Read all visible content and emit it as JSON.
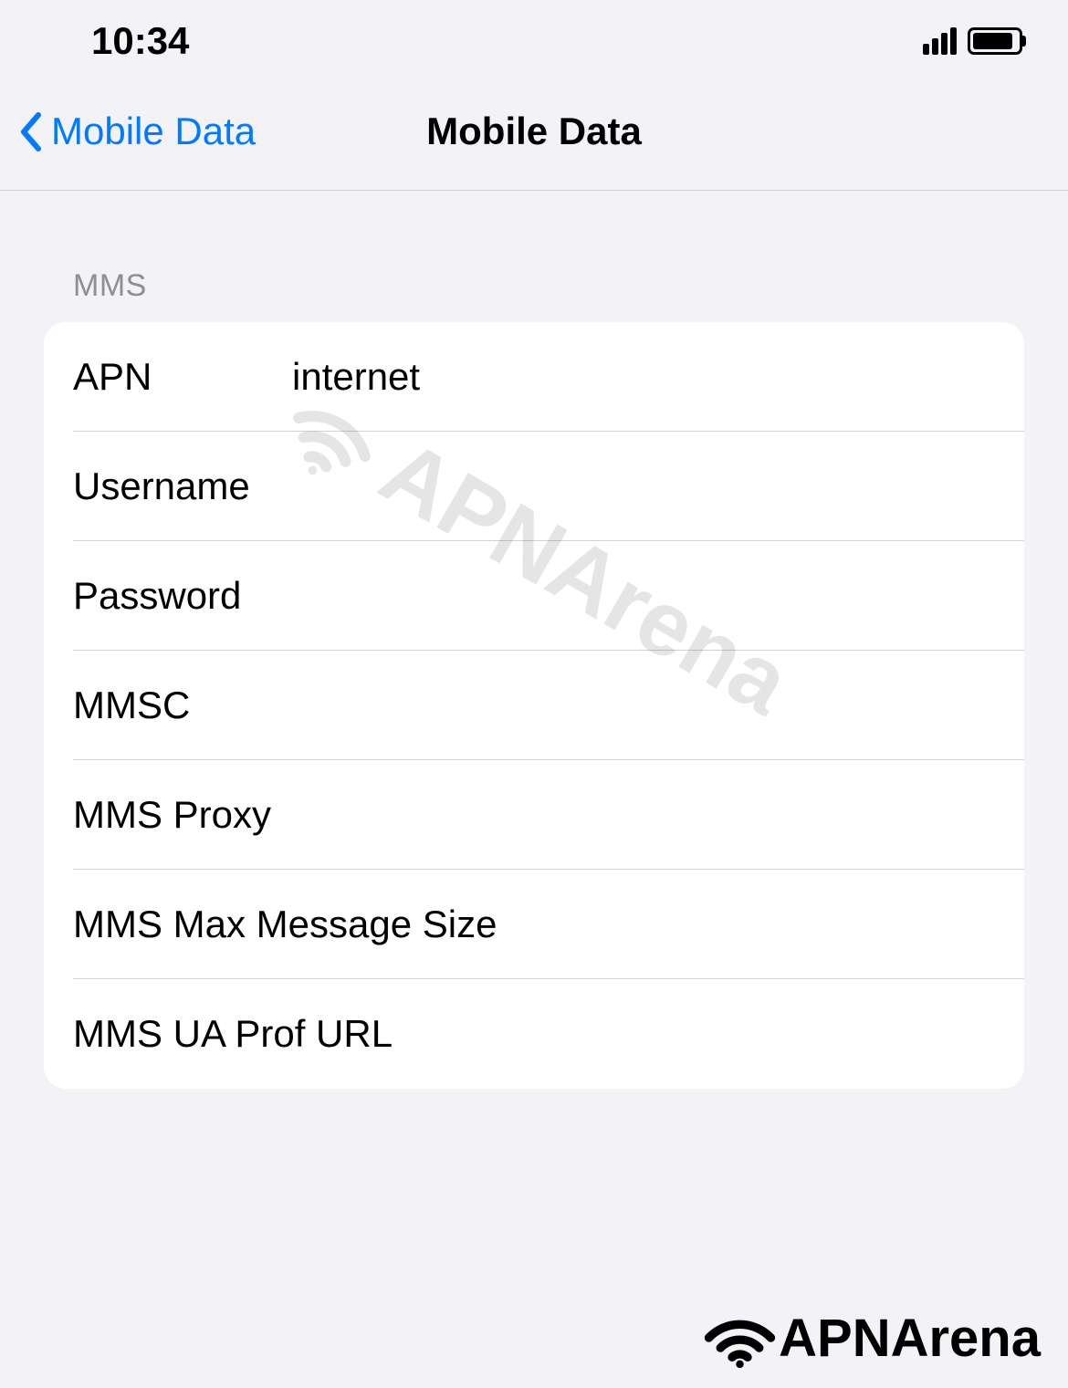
{
  "status_bar": {
    "time": "10:34"
  },
  "nav": {
    "back_label": "Mobile Data",
    "title": "Mobile Data"
  },
  "section": {
    "header": "MMS"
  },
  "fields": {
    "apn": {
      "label": "APN",
      "value": "internet"
    },
    "username": {
      "label": "Username",
      "value": ""
    },
    "password": {
      "label": "Password",
      "value": ""
    },
    "mmsc": {
      "label": "MMSC",
      "value": ""
    },
    "mms_proxy": {
      "label": "MMS Proxy",
      "value": ""
    },
    "mms_max_size": {
      "label": "MMS Max Message Size",
      "value": ""
    },
    "mms_ua_prof": {
      "label": "MMS UA Prof URL",
      "value": ""
    }
  },
  "watermark": {
    "text": "APNArena"
  },
  "footer": {
    "text": "APNArena"
  }
}
